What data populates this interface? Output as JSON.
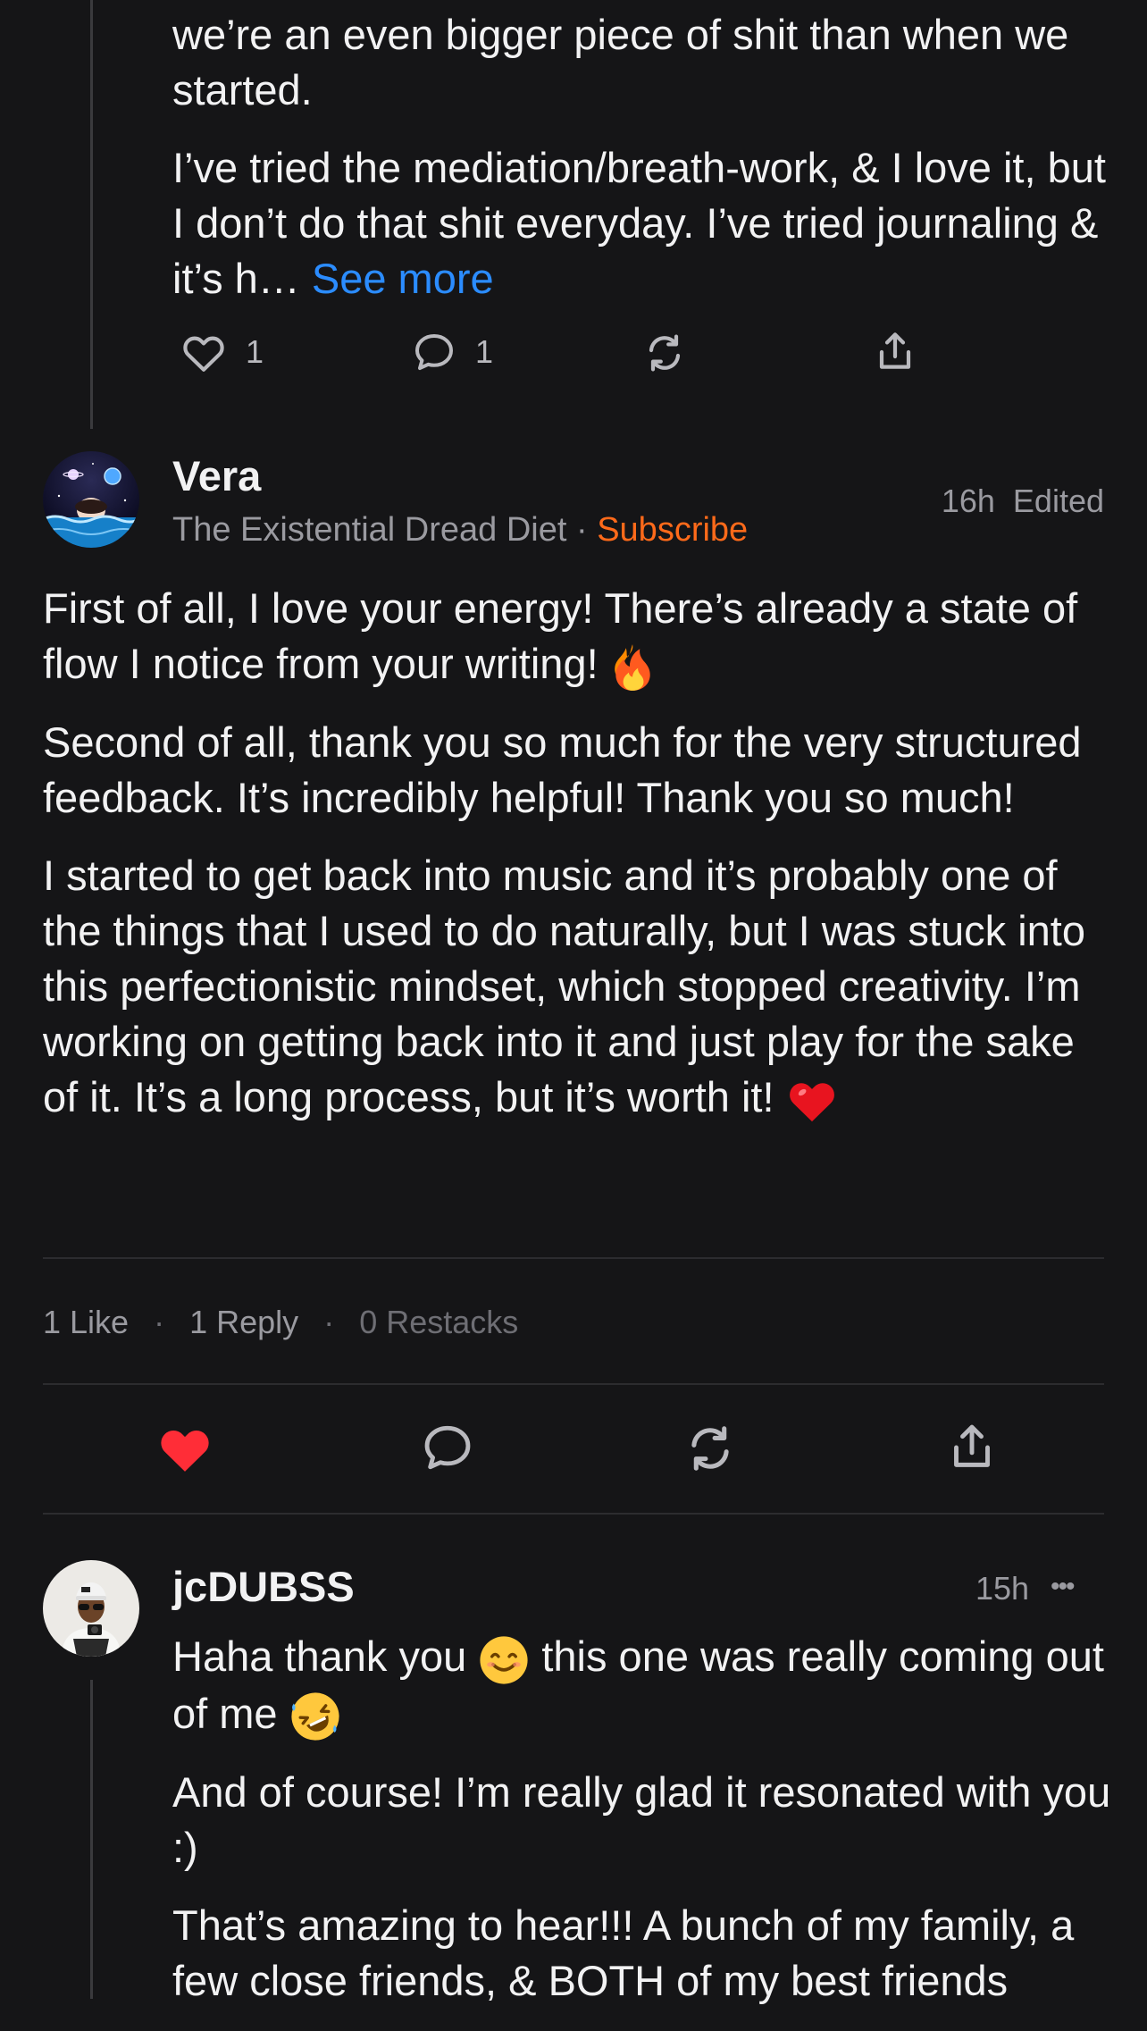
{
  "top_comment": {
    "paragraphs": [
      "we’re an even bigger piece of shit than when we started.",
      "I’ve tried the mediation/breath-work, & I love it, but I don’t do that shit everyday. I’ve tried journaling & it’s h…"
    ],
    "see_more": "See more",
    "actions": {
      "like_count": "1",
      "reply_count": "1"
    }
  },
  "vera_comment": {
    "author": "Vera",
    "publication": "The Existential Dread Diet",
    "separator": "·",
    "subscribe_label": "Subscribe",
    "time": "16h",
    "edited": "Edited",
    "paragraphs": [
      "First of all, I love your energy! There’s already a state of flow I notice from your writing!",
      "Second of all, thank you so much for the very structured feedback. It’s incredibly helpful! Thank you so much!",
      "I started to get back into music and it’s probably one of the things that I used to do naturally, but I was stuck into this perfectionistic mindset, which stopped creativity. I’m working on getting back into it and just play for the sake of it. It’s a long process, but it’s worth it!"
    ],
    "stats": {
      "likes": "1 Like",
      "replies": "1 Reply",
      "restacks": "0 Restacks",
      "dot": "·"
    },
    "liked": true
  },
  "reply_comment": {
    "author": "jcDUBSS",
    "time": "15h",
    "more": "•••",
    "paragraphs": [
      "Haha thank you",
      "this one was really coming out of me",
      "And of course! I’m really glad it resonated with you :)",
      "That’s amazing to hear!!! A bunch of my family, a few close friends, & BOTH of my best friends"
    ]
  },
  "colors": {
    "background": "#151517",
    "accent_orange": "#ff6a1a",
    "link_blue": "#2b8cff",
    "like_red": "#ff2d37"
  },
  "icons": [
    "heart-icon",
    "comment-icon",
    "restack-icon",
    "share-icon",
    "fire-emoji",
    "red-heart-emoji",
    "smile-emoji",
    "rofl-emoji"
  ]
}
